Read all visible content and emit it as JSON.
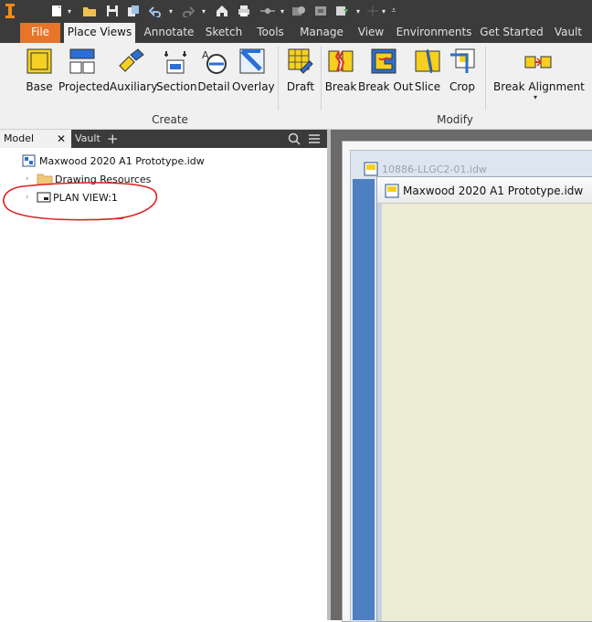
{
  "quick_access": {
    "app_icon": "inventor-logo-icon",
    "items": [
      "new-document-icon",
      "dropdown-icon",
      "open-folder-icon",
      "save-icon",
      "save-copy-icon",
      "undo-icon",
      "dropdown-icon",
      "redo-icon",
      "dropdown-icon",
      "home-icon",
      "print-icon",
      "measure-icon",
      "dropdown-icon",
      "appearance-icon",
      "material-icon",
      "update-icon",
      "dropdown-icon",
      "adjust-icon",
      "dropdown-icon",
      "customize-icon"
    ]
  },
  "ribbon_tabs": [
    "File",
    "Place Views",
    "Annotate",
    "Sketch",
    "Tools",
    "Manage",
    "View",
    "Environments",
    "Get Started",
    "Vault"
  ],
  "active_tab": "Place Views",
  "ribbon": {
    "create": {
      "label": "Create",
      "buttons": [
        "Base",
        "Projected",
        "Auxiliary",
        "Section",
        "Detail",
        "Overlay"
      ]
    },
    "sketch_button": "Draft",
    "modify": {
      "label": "Modify",
      "buttons": [
        "Break",
        "Break Out",
        "Slice",
        "Crop"
      ]
    },
    "break_alignment": "Break Alignment"
  },
  "browser": {
    "tabs": [
      {
        "label": "Model",
        "active": true
      },
      {
        "label": "Vault",
        "active": false
      }
    ],
    "add_symbol": "+",
    "close_symbol": "✕",
    "tree": [
      {
        "label": "Maxwood 2020 A1 Prototype.idw",
        "icon": "drawing-file-icon",
        "level": 0
      },
      {
        "label": "Drawing Resources",
        "icon": "folder-icon",
        "level": 1
      },
      {
        "label": "PLAN VIEW:1",
        "icon": "sheet-icon",
        "level": 1
      }
    ]
  },
  "annotation": {
    "color": "#e02020"
  },
  "documents": {
    "back": "10886-LLGC2-01.idw",
    "front": "Maxwood 2020 A1 Prototype.idw"
  },
  "colors": {
    "file_tab": "#e8742a",
    "dark_bar": "#3b3b3b",
    "ribbon_bg": "#f0f0f0",
    "drawing_bg": "#ececd4"
  }
}
